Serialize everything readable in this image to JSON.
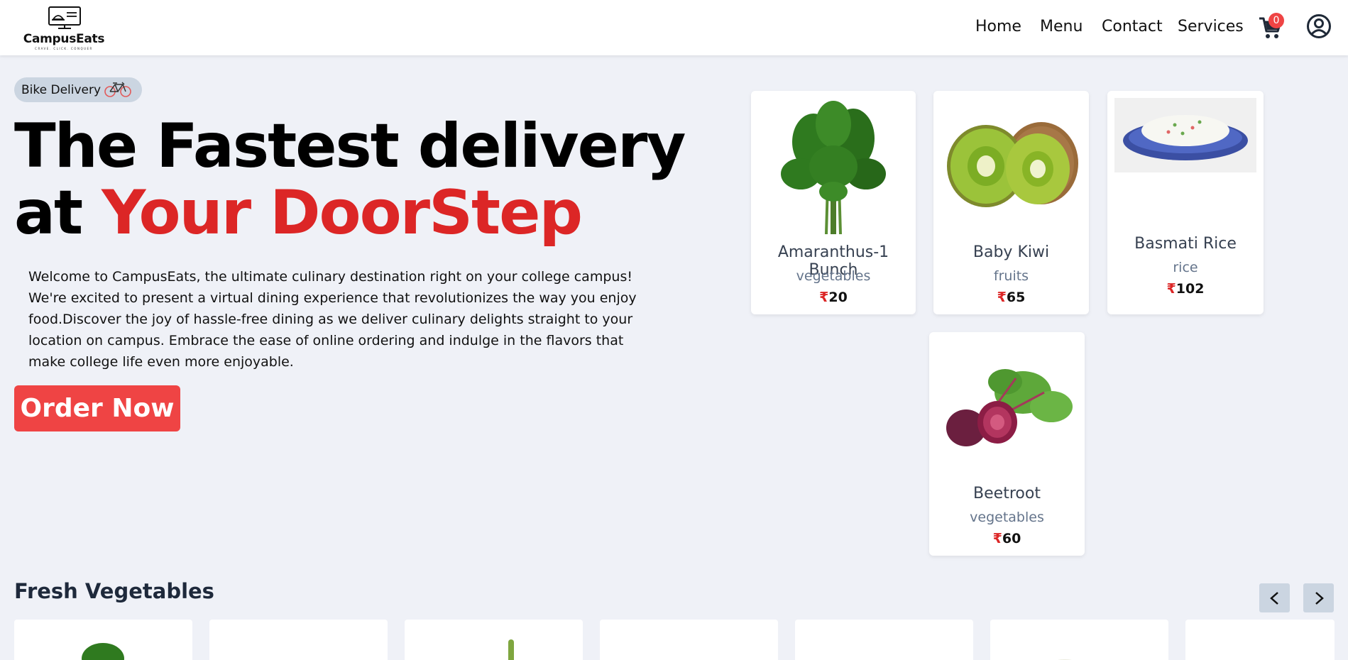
{
  "header": {
    "logo_name": "CampusEats",
    "logo_tagline": "CRAVE. CLICK. CONQUER",
    "nav": [
      "Home",
      "Menu",
      "Contact",
      "Services"
    ],
    "cart_count": "0"
  },
  "hero": {
    "badge": "Bike Delivery",
    "headline_line1": "The Fastest delivery",
    "headline_line2_prefix": "at ",
    "headline_line2_highlight": "Your DoorStep",
    "description": "Welcome to CampusEats, the ultimate culinary destination right on your college campus! We're excited to present a virtual dining experience that revolutionizes the way you enjoy food.Discover the joy of hassle-free dining as we deliver culinary delights straight to your location on campus. Embrace the ease of online ordering and indulge in the flavors that make college life even more enjoyable.",
    "cta": "Order Now"
  },
  "featured": [
    {
      "title": "Amaranthus-1 Bunch",
      "category": "vegetables",
      "price": "20",
      "icon": "spinach-image"
    },
    {
      "title": "Baby Kiwi",
      "category": "fruits",
      "price": "65",
      "icon": "kiwi-image"
    },
    {
      "title": "Basmati Rice",
      "category": "rice",
      "price": "102",
      "icon": "rice-image"
    },
    {
      "title": "Beetroot",
      "category": "vegetables",
      "price": "60",
      "icon": "beetroot-image"
    }
  ],
  "currency_symbol": "₹",
  "section": {
    "title": "Fresh Vegetables"
  },
  "colors": {
    "accent_red": "#dc2626",
    "button_red": "#ef4444",
    "page_bg": "#eff1f7"
  }
}
